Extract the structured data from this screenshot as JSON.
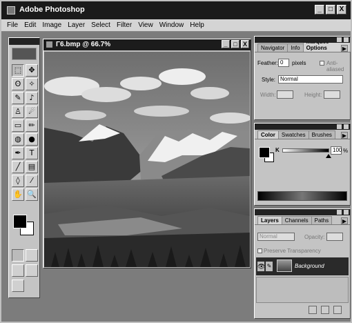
{
  "app": {
    "title": "Adobe Photoshop"
  },
  "window_buttons": {
    "minimize": "_",
    "restore": "□",
    "close": "X"
  },
  "menu": [
    "File",
    "Edit",
    "Image",
    "Layer",
    "Select",
    "Filter",
    "View",
    "Window",
    "Help"
  ],
  "document": {
    "title": "Γ6.bmp @ 66.7%"
  },
  "marquee_panel": {
    "tabs": [
      "Navigator",
      "Info",
      "Marquee Options"
    ],
    "feather_label": "Feather:",
    "feather_value": "0",
    "feather_unit": "pixels",
    "anti_aliased_label": "Anti-aliased",
    "style_label": "Style:",
    "style_value": "Normal",
    "width_label": "Width:",
    "height_label": "Height:"
  },
  "color_panel": {
    "tabs": [
      "Color",
      "Swatches",
      "Brushes"
    ],
    "channel_label": "K",
    "channel_value": "100",
    "channel_unit": "%"
  },
  "layers_panel": {
    "tabs": [
      "Layers",
      "Channels",
      "Paths"
    ],
    "mode_value": "Normal",
    "opacity_label": "Opacity:",
    "preserve_label": "Preserve Transparency",
    "layer_name": "Background"
  },
  "icons": {
    "marquee": "⬚",
    "move": "✥",
    "lasso": "ʘ",
    "magic_wand": "✧",
    "airbrush": "✎",
    "paintbrush": "♪",
    "stamp": "♙",
    "smudge": "☄",
    "eraser": "▭",
    "pencil": "✏",
    "blur": "◍",
    "burn": "●",
    "pen": "✒",
    "type": "T",
    "line": "╱",
    "gradient": "▤",
    "bucket": "◊",
    "eyedropper": "⁄",
    "hand": "✋",
    "zoom": "🔍"
  }
}
